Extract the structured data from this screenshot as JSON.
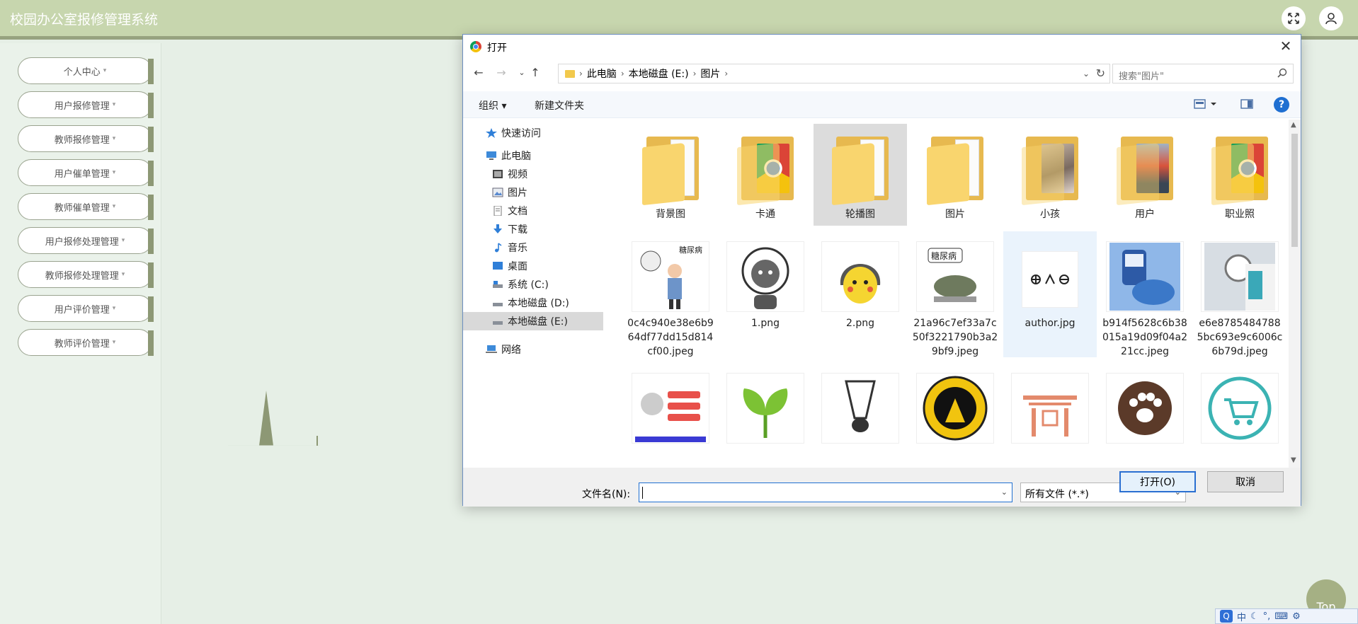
{
  "app": {
    "title": "校园办公室报修管理系统"
  },
  "sidebar": {
    "items": [
      {
        "label": "个人中心"
      },
      {
        "label": "用户报修管理"
      },
      {
        "label": "教师报修管理"
      },
      {
        "label": "用户催单管理"
      },
      {
        "label": "教师催单管理"
      },
      {
        "label": "用户报修处理管理"
      },
      {
        "label": "教师报修处理管理"
      },
      {
        "label": "用户评价管理"
      },
      {
        "label": "教师评价管理"
      }
    ],
    "caret": "▾"
  },
  "top_button": "Top",
  "ime": {
    "logo": "Q",
    "mode": "中"
  },
  "dialog": {
    "title": "打开",
    "breadcrumb": [
      "此电脑",
      "本地磁盘 (E:)",
      "图片"
    ],
    "search_placeholder": "搜索\"图片\"",
    "toolbar": {
      "organize": "组织 ▾",
      "new_folder": "新建文件夹",
      "help": "?"
    },
    "nav": {
      "quick_access": "快速访问",
      "this_pc": "此电脑",
      "items": [
        "视频",
        "图片",
        "文档",
        "下载",
        "音乐",
        "桌面",
        "系统 (C:)",
        "本地磁盘 (D:)",
        "本地磁盘 (E:)"
      ],
      "network": "网络"
    },
    "files": [
      {
        "name": "背景图",
        "kind": "folder"
      },
      {
        "name": "卡通",
        "kind": "folder"
      },
      {
        "name": "轮播图",
        "kind": "folder"
      },
      {
        "name": "图片",
        "kind": "folder"
      },
      {
        "name": "小孩",
        "kind": "folder"
      },
      {
        "name": "用户",
        "kind": "folder"
      },
      {
        "name": "职业照",
        "kind": "folder"
      },
      {
        "name": "0c4c940e38e6b964df77dd15d814cf00.jpeg",
        "kind": "image",
        "caption": "糖尿病"
      },
      {
        "name": "1.png",
        "kind": "image"
      },
      {
        "name": "2.png",
        "kind": "image"
      },
      {
        "name": "21a96c7ef33a7c50f3221790b3a29bf9.jpeg",
        "kind": "image",
        "caption": "糖尿病"
      },
      {
        "name": "author.jpg",
        "kind": "image"
      },
      {
        "name": "b914f5628c6b38015a19d09f04a221cc.jpeg",
        "kind": "image"
      },
      {
        "name": "e6e87854847885bc693e9c6006c6b79d.jpeg",
        "kind": "image"
      }
    ],
    "file_name_label": "文件名(N):",
    "file_name_value": "",
    "file_type": "所有文件 (*.*)",
    "open_button": "打开(O)",
    "cancel_button": "取消"
  }
}
